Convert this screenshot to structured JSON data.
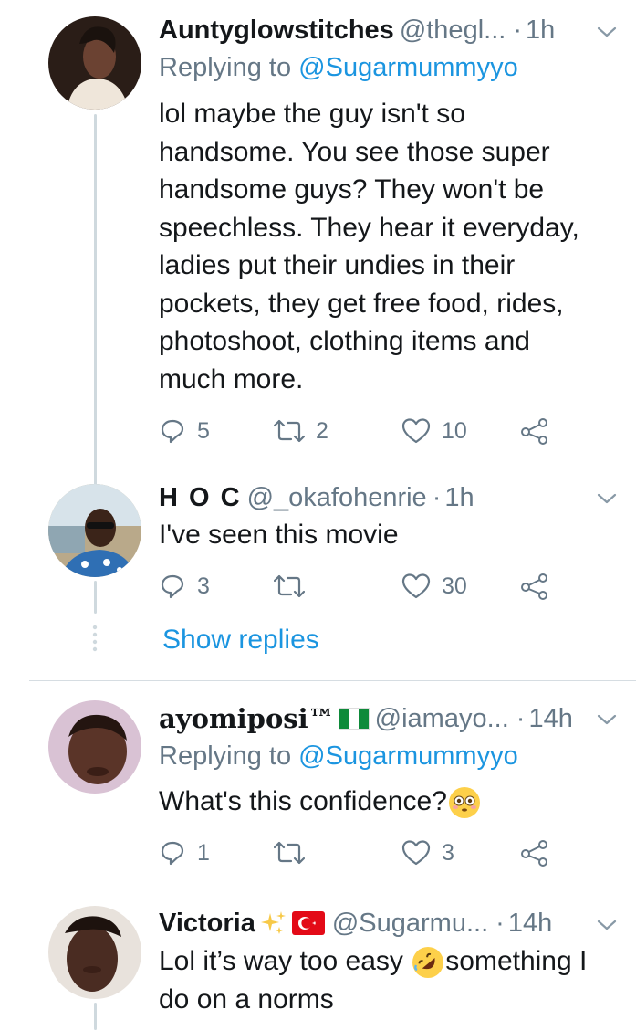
{
  "tweets": [
    {
      "name": "Auntyglowstitches",
      "handle": "@thegl...",
      "dot": "·",
      "time": "1h",
      "replying_prefix": "Replying to",
      "replying_to": "@Sugarmummyyo",
      "lines": [
        "lol maybe the guy isn't so",
        "handsome. You see those super",
        "handsome guys? They won't be",
        "speechless. They hear it everyday,",
        "ladies put their undies in their",
        "pockets,  they get free food, rides,",
        "photoshoot, clothing items and",
        "much more."
      ],
      "replies": "5",
      "retweets": "2",
      "likes": "10"
    },
    {
      "name": "H O C",
      "handle": "@_okafohenrie",
      "dot": "·",
      "time": "1h",
      "lines": [
        "I've seen this movie"
      ],
      "replies": "3",
      "retweets": "",
      "likes": "30"
    },
    {
      "name": "ayomiposi™",
      "handle": "@iamayo...",
      "dot": "·",
      "time": "14h",
      "replying_prefix": "Replying to",
      "replying_to": "@Sugarmummyyo",
      "text": "What's this confidence?",
      "emoji": "flushed-face",
      "replies": "1",
      "retweets": "",
      "likes": "3"
    },
    {
      "name": "Victoria",
      "handle": "@Sugarmu...",
      "dot": "·",
      "time": "14h",
      "line1_a": "Lol it’s way too easy",
      "line1_b": "something I",
      "line2": "do on a norms",
      "emoji": "rolling-on-floor-laughing-face"
    }
  ],
  "show_replies": "Show replies",
  "colors": {
    "link": "#1b95e0",
    "muted": "#657786",
    "text": "#14171a",
    "thread_line": "#cfd9de"
  }
}
